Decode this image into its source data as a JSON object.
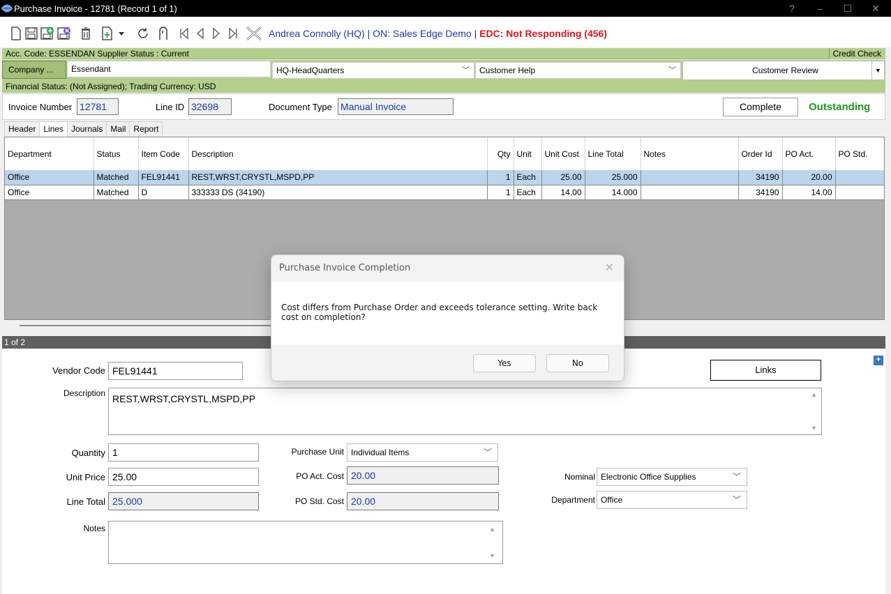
{
  "window": {
    "title": "Purchase Invoice - 12781  (Record 1 of 1)",
    "help": "?",
    "minimize": "–",
    "maximize": "☐",
    "close": "✕"
  },
  "toolbar": {
    "user": "Andrea Connolly (HQ) | ON: Sales Edge Demo | ",
    "edc_status": "EDC: Not Responding  (456)"
  },
  "account": {
    "summary": "Acc. Code: ESSENDAN  Supplier Status : Current",
    "credit_check": "Credit Check",
    "company_label": "Company ...",
    "company_name": "Essendant",
    "headquarters": "HQ-HeadQuarters",
    "customer_help": "Customer Help",
    "customer_review": "Customer Review",
    "financial_status": "Financial Status: (Not Assigned); Trading Currency: USD"
  },
  "invoice": {
    "number_label": "Invoice Number",
    "number": "12781",
    "line_id_label": "Line ID",
    "line_id": "32698",
    "doc_type_label": "Document Type",
    "doc_type": "Manual Invoice",
    "complete_label": "Complete",
    "status": "Outstanding"
  },
  "tabs": [
    "Header",
    "Lines",
    "Journals",
    "Mail",
    "Report"
  ],
  "grid": {
    "columns": [
      "Department",
      "Status",
      "Item Code",
      "Description",
      "Qty",
      "Unit",
      "Unit Cost",
      "Line Total",
      "Notes",
      "Order Id",
      "PO Act.",
      "PO Std."
    ],
    "rows": [
      [
        "Office",
        "Matched",
        "FEL91441",
        "REST,WRST,CRYSTL,MSPD,PP",
        "1",
        "Each",
        "25.00",
        "25.000",
        "",
        "34190",
        "20.00",
        ""
      ],
      [
        "Office",
        "Matched",
        "D",
        "333333 DS (34190)",
        "1",
        "Each",
        "14.00",
        "14.000",
        "",
        "34190",
        "14.00",
        ""
      ]
    ],
    "pager": "1 of 2"
  },
  "detail": {
    "vendor_code_label": "Vendor Code",
    "vendor_code": "FEL91441",
    "links_label": "Links",
    "plus": "+",
    "description_label": "Description",
    "description": "REST,WRST,CRYSTL,MSPD,PP",
    "quantity_label": "Quantity",
    "quantity": "1",
    "purchase_unit_label": "Purchase Unit",
    "purchase_unit": "Individual Items",
    "unit_price_label": "Unit Price",
    "unit_price": "25.00",
    "po_act_cost_label": "PO Act. Cost",
    "po_act_cost": "20.00",
    "nominal_label": "Nominal",
    "nominal": "Electronic Office Supplies",
    "line_total_label": "Line Total",
    "line_total": "25.000",
    "po_std_cost_label": "PO Std. Cost",
    "po_std_cost": "20.00",
    "department_label": "Department",
    "department": "Office",
    "notes_label": "Notes",
    "notes": ""
  },
  "dialog": {
    "title": "Purchase Invoice Completion",
    "message": "Cost differs from Purchase Order and exceeds tolerance setting. Write back cost on completion?",
    "yes": "Yes",
    "no": "No"
  }
}
